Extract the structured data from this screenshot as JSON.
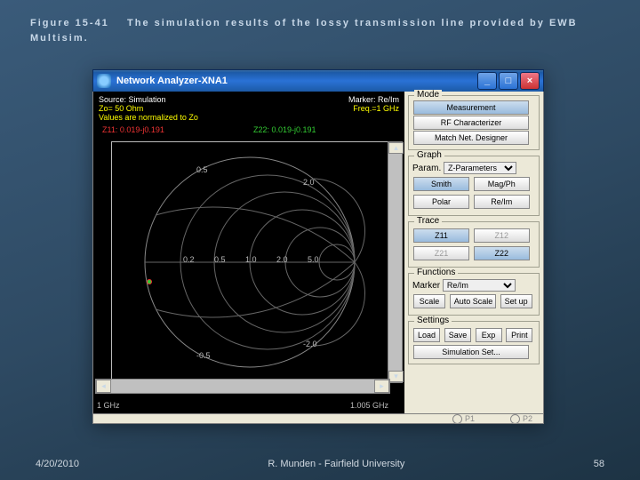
{
  "slide": {
    "title_num": "Figure 15-41",
    "title_text": "The simulation results of the lossy transmission line provided by EWB Multisim.",
    "date": "4/20/2010",
    "author": "R. Munden - Fairfield University",
    "page": "58"
  },
  "window": {
    "title": "Network Analyzer-XNA1"
  },
  "plot": {
    "source_label": "Source: Simulation",
    "marker_label": "Marker: Re/Im",
    "zo_label": "Zo= 50 Ohm",
    "freq_label": "Freq.=1 GHz",
    "norm_label": "Values are normalized to Zo",
    "z11": "Z11: 0.019-j0.191",
    "z22": "Z22: 0.019-j0.191",
    "xmin": "1 GHz",
    "xmax": "1.005 GHz",
    "tick_pos_top": "0.5",
    "tick_pos_mid": "2.0",
    "tick_neg_bot": "-0.5",
    "tick_neg_mid": "-2.0",
    "tick_x_02": "0.2",
    "tick_x_05": "0.5",
    "tick_x_10": "1.0",
    "tick_x_20": "2.0",
    "tick_x_50": "5.0"
  },
  "panel": {
    "mode_label": "Mode",
    "measurement": "Measurement",
    "rf_char": "RF Characterizer",
    "match_net": "Match Net. Designer",
    "graph_label": "Graph",
    "param_label": "Param.",
    "param_value": "Z-Parameters",
    "smith": "Smith",
    "magph": "Mag/Ph",
    "polar": "Polar",
    "reim": "Re/Im",
    "trace_label": "Trace",
    "z11": "Z11",
    "z12": "Z12",
    "z21": "Z21",
    "z22": "Z22",
    "functions_label": "Functions",
    "marker_label": "Marker",
    "marker_value": "Re/Im",
    "scale": "Scale",
    "autoscale": "Auto Scale",
    "setup": "Set up",
    "settings_label": "Settings",
    "load": "Load",
    "save": "Save",
    "exp": "Exp",
    "print": "Print",
    "simset": "Simulation Set...",
    "p1": "P1",
    "p2": "P2"
  },
  "chart_data": {
    "type": "smith",
    "title": "Z-Parameters (normalized to Zo)",
    "zo_ohm": 50,
    "frequency_start_ghz": 1.0,
    "frequency_stop_ghz": 1.005,
    "marker_frequency_ghz": 1.0,
    "marker_format": "Re/Im",
    "resistance_circles": [
      0.2,
      0.5,
      1.0,
      2.0,
      5.0
    ],
    "reactance_arcs": [
      0.5,
      2.0,
      -0.5,
      -2.0
    ],
    "series": [
      {
        "name": "Z11",
        "color": "red",
        "re": 0.019,
        "im": -0.191
      },
      {
        "name": "Z22",
        "color": "green",
        "re": 0.019,
        "im": -0.191
      }
    ]
  }
}
